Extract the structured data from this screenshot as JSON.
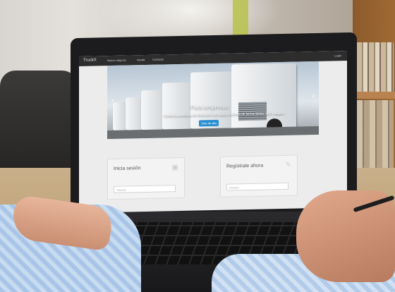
{
  "website": {
    "logo": "TruckX",
    "nav_links": [
      "Nuevo negocio",
      "Ayuda",
      "Contacto"
    ],
    "login": "Login",
    "hero": {
      "title": "Para empresas",
      "subtitle": "Conecta tu empresa de transporte con nuevos clientes de forma rápida, fácil y segura",
      "button": "Date de alta",
      "prev_icon": "‹",
      "next_icon": "›"
    },
    "login_panel": {
      "title": "Inicia sesión",
      "input_placeholder": "Usuario",
      "icon": "lock-icon"
    },
    "register_panel": {
      "title": "Regístrate ahora",
      "input_placeholder": "Usuario",
      "icon": "pencil-icon"
    }
  },
  "colors": {
    "navbar": "#2d2d2d",
    "button": "#2a8fd0",
    "page_bg": "#ececec"
  }
}
